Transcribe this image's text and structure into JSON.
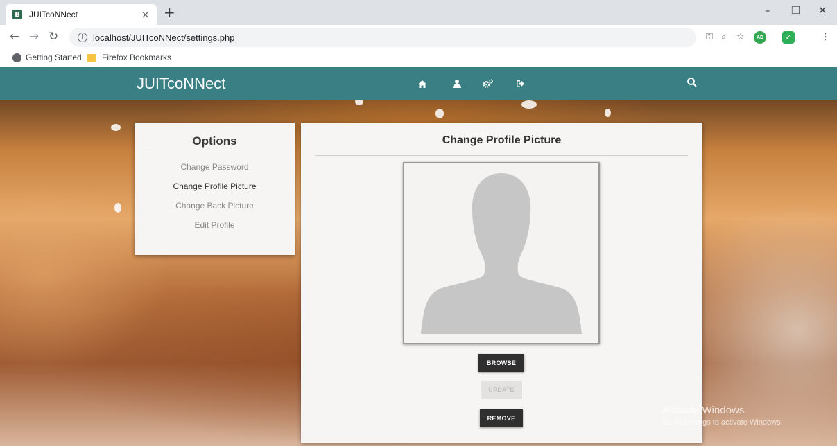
{
  "browser": {
    "tab_title": "JUITcoNNect",
    "tab_close": "×",
    "new_tab": "+",
    "favicon_letter": "B",
    "url": "localhost/JUITcoNNect/settings.php",
    "extension_avatar": "AD",
    "bookmarks": [
      "Getting Started",
      "Firefox Bookmarks"
    ]
  },
  "navbar": {
    "brand": "JUITcoNNect",
    "icons": [
      "home-icon",
      "user-icon",
      "settings-icon",
      "logout-icon",
      "search-icon"
    ]
  },
  "options": {
    "title": "Options",
    "items": [
      {
        "label": "Change Password",
        "active": false
      },
      {
        "label": "Change Profile Picture",
        "active": true
      },
      {
        "label": "Change Back Picture",
        "active": false
      },
      {
        "label": "Edit Profile",
        "active": false
      }
    ]
  },
  "main": {
    "title": "Change Profile Picture",
    "browse_label": "BROWSE",
    "update_label": "UPDATE",
    "remove_label": "REMOVE"
  },
  "watermark": {
    "line1": "Activate Windows",
    "line2": "Go to Settings to activate Windows."
  },
  "colors": {
    "navbar": "#3a7f83",
    "card": "#f7f5f3",
    "button_dark": "#2f2f2f"
  }
}
